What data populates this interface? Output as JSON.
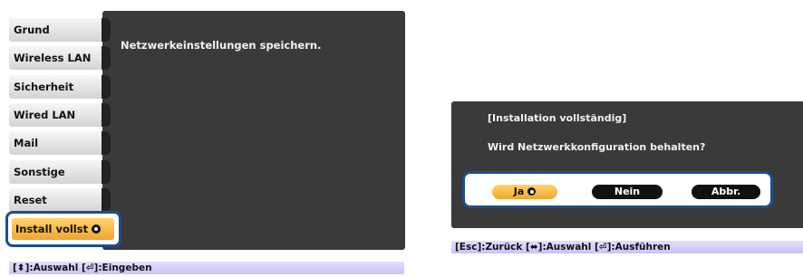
{
  "left_screen": {
    "sidebar": {
      "items": [
        {
          "label": "Grund"
        },
        {
          "label": "Wireless LAN"
        },
        {
          "label": "Sicherheit"
        },
        {
          "label": "Wired LAN"
        },
        {
          "label": "Mail"
        },
        {
          "label": "Sonstige"
        },
        {
          "label": "Reset"
        }
      ],
      "selected_item": {
        "label": "Install vollst"
      }
    },
    "panel_message": "Netzwerkeinstellungen speichern.",
    "footer": "[⬍]:Auswahl [⏎]:Eingeben"
  },
  "right_screen": {
    "dialog": {
      "title": "[Installation vollständig]",
      "question": "Wird Netzwerkkonfiguration behalten?",
      "buttons": {
        "yes": "Ja",
        "no": "Nein",
        "cancel": "Abbr."
      },
      "selected_button": "Ja"
    },
    "footer": "[Esc]:Zurück [⬌]:Auswahl [⏎]:Ausführen"
  },
  "colors": {
    "panel": "#3a3a3a",
    "highlight": "#f0a62e",
    "focus_frame": "#1d4f8a",
    "footer_bar": "#d4cffa"
  }
}
